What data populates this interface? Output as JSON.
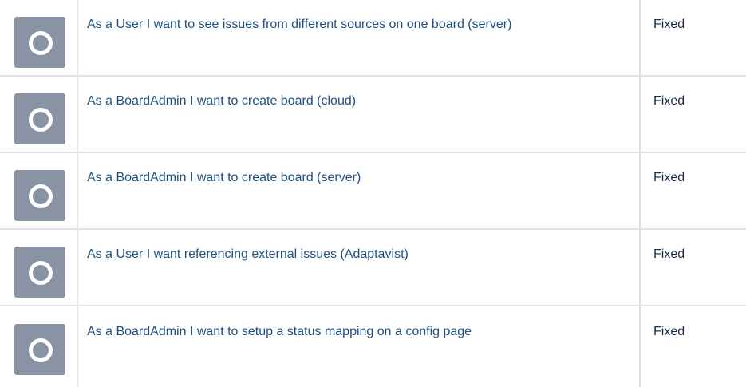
{
  "issues": [
    {
      "title": "As a User I want to see issues from different sources on one board (server)",
      "status": "Fixed",
      "icon": "issue-type-icon"
    },
    {
      "title": "As a BoardAdmin I want to create board (cloud)",
      "status": "Fixed",
      "icon": "issue-type-icon"
    },
    {
      "title": "As a BoardAdmin I want to create board (server)",
      "status": "Fixed",
      "icon": "issue-type-icon"
    },
    {
      "title": "As a User I want referencing external issues (Adaptavist)",
      "status": "Fixed",
      "icon": "issue-type-icon"
    },
    {
      "title": "As a BoardAdmin I want to setup a status mapping on a config page",
      "status": "Fixed",
      "icon": "issue-type-icon"
    }
  ],
  "colors": {
    "link": "#205081",
    "icon_bg": "#8993a4",
    "border": "#dfe1e6"
  }
}
